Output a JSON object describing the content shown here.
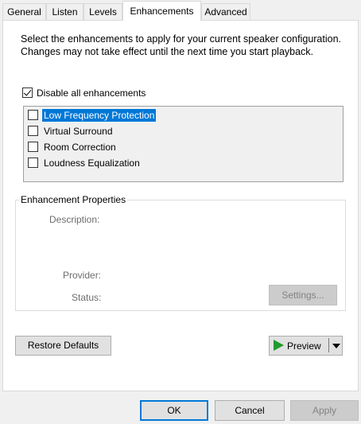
{
  "tabs": [
    {
      "label": "General"
    },
    {
      "label": "Listen"
    },
    {
      "label": "Levels"
    },
    {
      "label": "Enhancements"
    },
    {
      "label": "Advanced"
    }
  ],
  "active_tab": "Enhancements",
  "description": "Select the enhancements to apply for your current speaker configuration. Changes may not take effect until the next time you start playback.",
  "disable_all": {
    "label": "Disable all enhancements",
    "checked": true
  },
  "enhancements": [
    {
      "label": "Low Frequency Protection",
      "checked": false,
      "selected": true
    },
    {
      "label": "Virtual Surround",
      "checked": false,
      "selected": false
    },
    {
      "label": "Room Correction",
      "checked": false,
      "selected": false
    },
    {
      "label": "Loudness Equalization",
      "checked": false,
      "selected": false
    }
  ],
  "properties": {
    "title": "Enhancement Properties",
    "description_label": "Description:",
    "provider_label": "Provider:",
    "status_label": "Status:",
    "settings_button": "Settings..."
  },
  "restore_defaults": "Restore Defaults",
  "preview_button": "Preview",
  "dialog_buttons": {
    "ok": "OK",
    "cancel": "Cancel",
    "apply": "Apply"
  },
  "colors": {
    "selection": "#0078d7",
    "play_icon": "#1f9b2e"
  }
}
